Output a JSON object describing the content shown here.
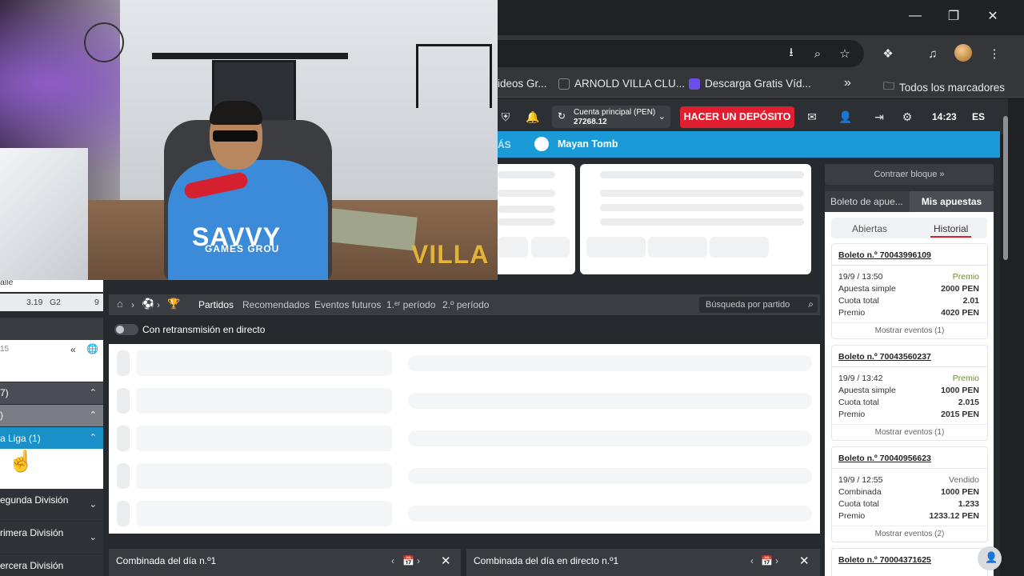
{
  "browser": {
    "bookmarks": [
      {
        "label": "ideos Gr..."
      },
      {
        "label": "ARNOLD VILLA CLU..."
      },
      {
        "label": "Descarga Gratis Víd..."
      },
      {
        "label": "Todos los marcadores"
      }
    ],
    "more_bookmarks": "»"
  },
  "header": {
    "account_label": "Cuenta principal  (PEN)",
    "account_balance": "27268.12",
    "deposit_button": "HACER UN DEPÓSITO",
    "time": "14:23",
    "language": "ES"
  },
  "nav": {
    "more_label": "ÁS",
    "featured_game": "Mayan Tomb"
  },
  "sidebar": {
    "top_label": "alle",
    "odds": [
      "3.19",
      "G2",
      "9"
    ],
    "item_number": "15",
    "rows": [
      {
        "label": "7)"
      },
      {
        "label": ")"
      },
      {
        "label": "a Liga (1)"
      },
      {
        "label": "egunda División"
      },
      {
        "label": "rimera División"
      },
      {
        "label": "ercera División"
      }
    ]
  },
  "filters": {
    "tabs": [
      "Partidos",
      "Recomendados",
      "Eventos futuros",
      "1.ᵉʳ período",
      "2.º período"
    ],
    "search_placeholder": "Búsqueda por partido",
    "live_toggle_label": "Con retransmisión en directo"
  },
  "combos": [
    {
      "title": "Combinada del día n.º1"
    },
    {
      "title": "Combinada del día en directo n.º1"
    }
  ],
  "right_panel": {
    "collapse_label": "Contraer bloque »",
    "tabs": [
      "Boleto de apue...",
      "Mis apuestas"
    ],
    "subtabs": [
      "Abiertas",
      "Historial"
    ],
    "tickets": [
      {
        "id": "Boleto n.º 70043996109",
        "date": "19/9 / 13:50",
        "status": "Premio",
        "type": "Apuesta simple",
        "stake": "2000 PEN",
        "odds_label": "Cuota total",
        "odds": "2.01",
        "prize_label": "Premio",
        "prize": "4020 PEN",
        "more": "Mostrar eventos (1)"
      },
      {
        "id": "Boleto n.º 70043560237",
        "date": "19/9 / 13:42",
        "status": "Premio",
        "type": "Apuesta simple",
        "stake": "1000 PEN",
        "odds_label": "Cuota total",
        "odds": "2.015",
        "prize_label": "Premio",
        "prize": "2015 PEN",
        "more": "Mostrar eventos (1)"
      },
      {
        "id": "Boleto n.º 70040956623",
        "date": "19/9 / 12:55",
        "status": "Vendido",
        "type": "Combinada",
        "stake": "1000 PEN",
        "odds_label": "Cuota total",
        "odds": "1.233",
        "prize_label": "Premio",
        "prize": "1233.12 PEN",
        "more": "Mostrar eventos (2)"
      },
      {
        "id": "Boleto n.º 70004371625"
      }
    ]
  },
  "webcam": {
    "shirt_text": "SAVVY",
    "shirt_sub": "GAMES GROU",
    "watermark": "VILLA"
  }
}
